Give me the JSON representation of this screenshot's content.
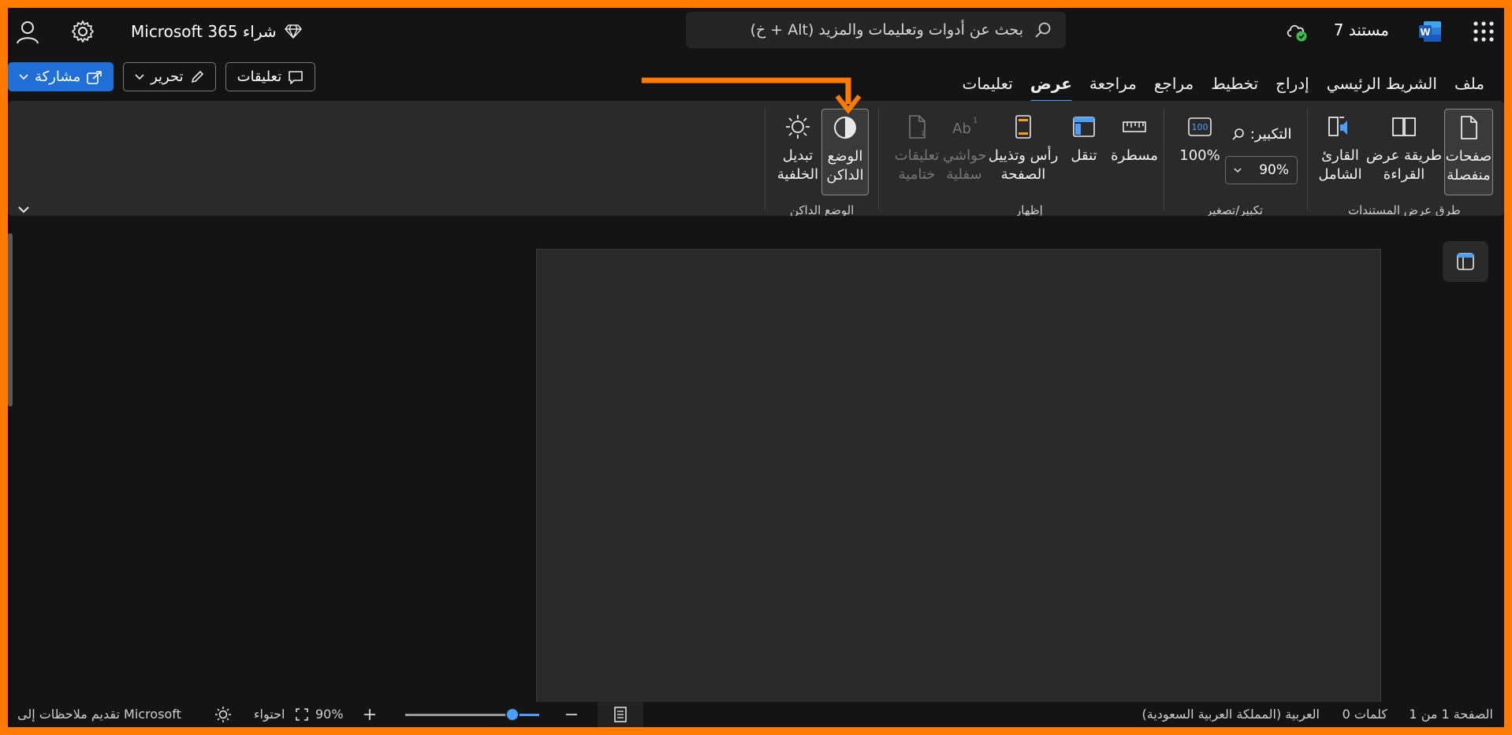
{
  "titlebar": {
    "buy_label": "شراء Microsoft 365",
    "search_placeholder": "بحث عن أدوات وتعليمات والمزيد (Alt + خ)",
    "doc_title": "مستند 7"
  },
  "tabs": [
    {
      "label": "ملف"
    },
    {
      "label": "الشريط الرئيسي"
    },
    {
      "label": "إدراج"
    },
    {
      "label": "تخطيط"
    },
    {
      "label": "مراجع"
    },
    {
      "label": "مراجعة"
    },
    {
      "label": "عرض",
      "active": true
    },
    {
      "label": "تعليمات"
    }
  ],
  "actions": {
    "share": "مشاركة",
    "edit": "تحرير",
    "comments": "تعليقات"
  },
  "ribbon": {
    "views": {
      "group_label": "طرق عرض المستندات",
      "separate_pages": [
        "صفحات",
        "منفصلة"
      ],
      "reading_view": [
        "طريقة عرض",
        "القراءة"
      ],
      "immersive_reader": [
        "القارئ",
        "الشامل"
      ]
    },
    "zoom": {
      "group_label": "تكبير/تصغير",
      "zoom_label": "التكبير:",
      "zoom_value": "90%",
      "hundred_label": "100%"
    },
    "show": {
      "group_label": "إظهار",
      "ruler": "مسطرة",
      "navigation": "تنقل",
      "header_footer": [
        "رأس وتذييل",
        "الصفحة"
      ],
      "footnotes": [
        "حواشي",
        "سفلية"
      ],
      "endnotes": [
        "تعليقات",
        "ختامية"
      ]
    },
    "dark_mode": {
      "group_label": "الوضع الداكن",
      "dark_mode": [
        "الوضع",
        "الداكن"
      ],
      "switch_background": [
        "تبديل",
        "الخلفية"
      ]
    }
  },
  "status": {
    "page_info": "الصفحة 1 من 1",
    "words": "0 كلمات",
    "language": "العربية (المملكة العربية السعودية)",
    "zoom_percent": "90%",
    "fit": "احتواء",
    "feedback": "تقديم ملاحظات إلى Microsoft",
    "zoom_level": 0.2
  },
  "colors": {
    "accent": "#4aa0ff",
    "annotation": "#ff7a00",
    "share_button": "#1f6fd6"
  }
}
